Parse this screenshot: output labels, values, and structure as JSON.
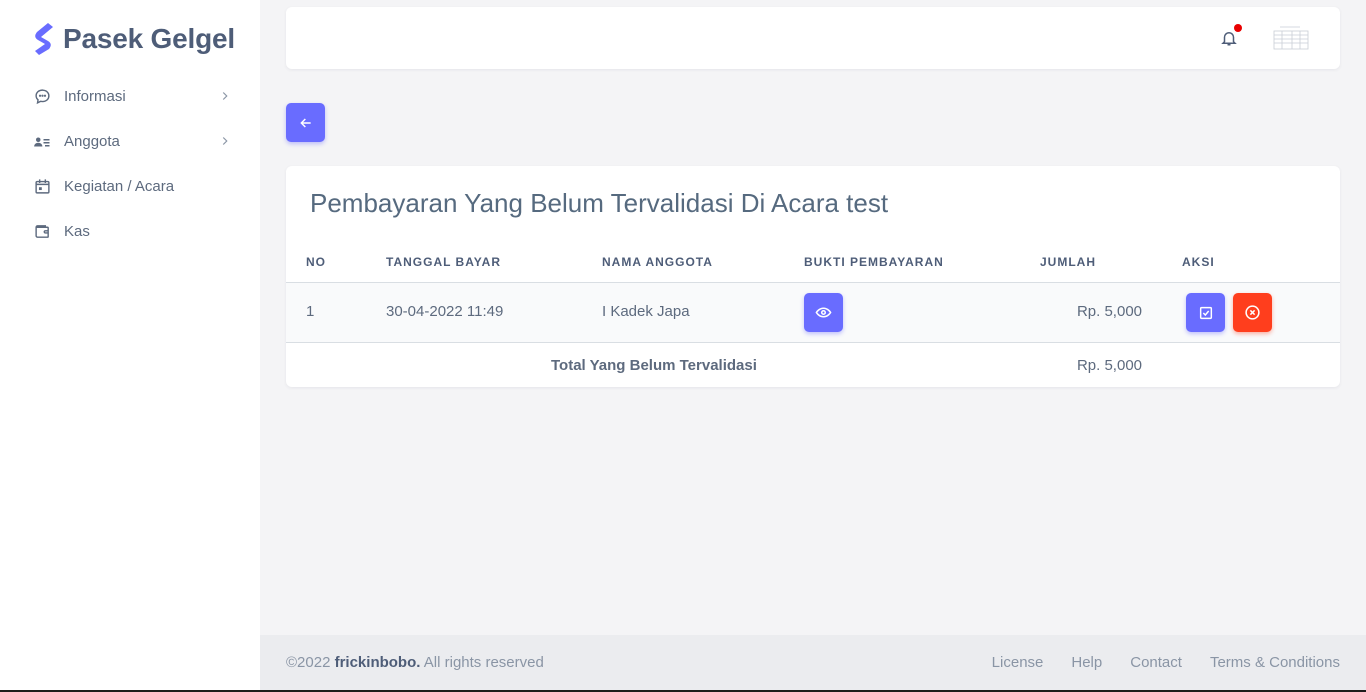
{
  "brand": {
    "name": "Pasek Gelgel",
    "accent": "#696cff"
  },
  "sidebar": {
    "items": [
      {
        "label": "Informasi",
        "icon": "chat-bubble-icon",
        "has_submenu": true
      },
      {
        "label": "Anggota",
        "icon": "user-list-icon",
        "has_submenu": true
      },
      {
        "label": "Kegiatan / Acara",
        "icon": "calendar-icon",
        "has_submenu": false
      },
      {
        "label": "Kas",
        "icon": "wallet-icon",
        "has_submenu": false
      }
    ]
  },
  "topbar": {
    "notification_icon": "bell-icon",
    "has_unread": true
  },
  "back_button": {
    "icon": "arrow-left-icon"
  },
  "card": {
    "title": "Pembayaran Yang Belum Tervalidasi Di Acara test",
    "columns": [
      "NO",
      "TANGGAL BAYAR",
      "NAMA ANGGOTA",
      "BUKTI PEMBAYARAN",
      "JUMLAH",
      "AKSI"
    ],
    "rows": [
      {
        "no": "1",
        "tanggal": "30-04-2022 11:49",
        "nama": "I Kadek Japa",
        "jumlah": "Rp. 5,000"
      }
    ],
    "total_label": "Total Yang Belum Tervalidasi",
    "total_value": "Rp. 5,000"
  },
  "footer": {
    "copyright_prefix": "©2022",
    "copyright_owner": "frickinbobo.",
    "copyright_suffix": "All rights reserved",
    "links": [
      "License",
      "Help",
      "Contact",
      "Terms & Conditions"
    ]
  },
  "colors": {
    "primary": "#696cff",
    "danger": "#ff3e1d",
    "notification_dot": "#e90000"
  }
}
